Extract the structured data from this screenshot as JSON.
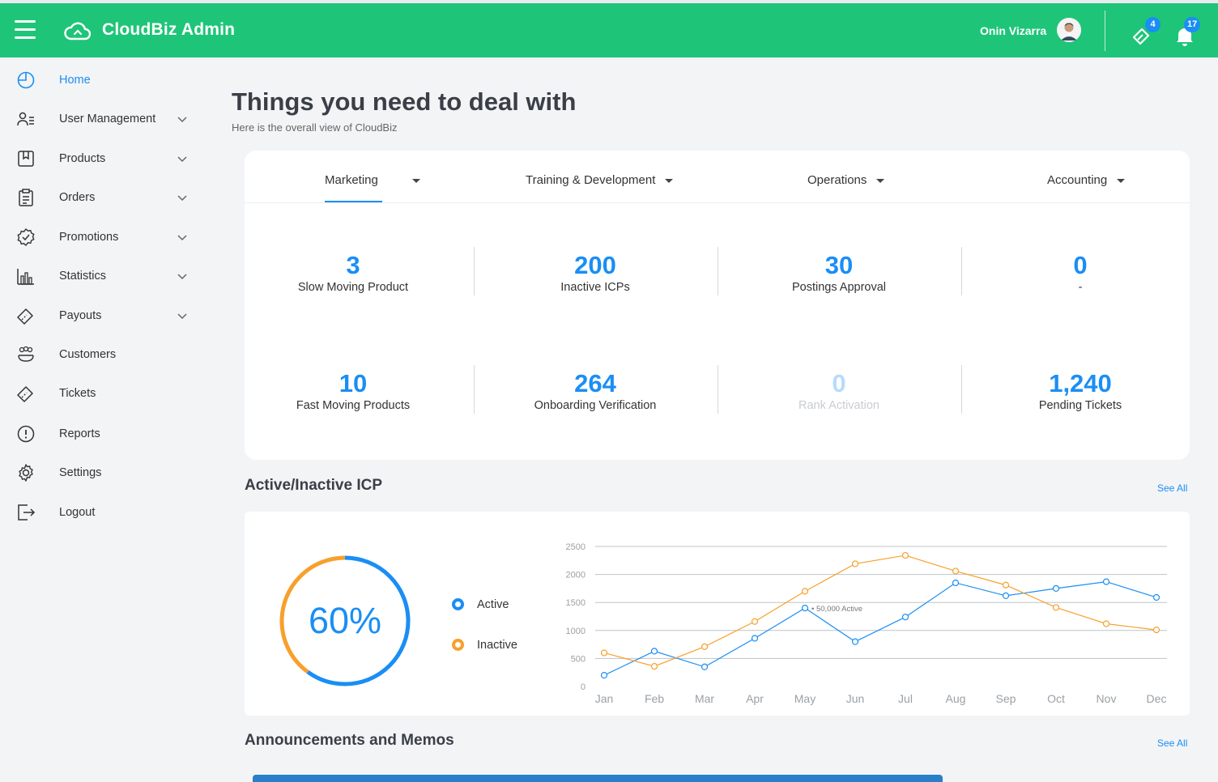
{
  "header": {
    "title": "CloudBiz Admin",
    "user_name": "Onin Vizarra",
    "ticket_badge": "4",
    "notification_badge": "17",
    "brand_color": "#1ec578",
    "accent_color": "#1a8ef5"
  },
  "sidebar": {
    "items": [
      {
        "label": "Home",
        "icon": "dashboard-icon",
        "active": true
      },
      {
        "label": "User Management",
        "icon": "users-icon",
        "expandable": true
      },
      {
        "label": "Products",
        "icon": "bookmark-icon",
        "expandable": true
      },
      {
        "label": "Orders",
        "icon": "clipboard-icon",
        "expandable": true
      },
      {
        "label": "Promotions",
        "icon": "badge-check-icon",
        "expandable": true
      },
      {
        "label": "Statistics",
        "icon": "bar-chart-icon",
        "expandable": true
      },
      {
        "label": "Payouts",
        "icon": "ticket-icon",
        "expandable": true
      },
      {
        "label": "Customers",
        "icon": "customers-icon"
      },
      {
        "label": "Tickets",
        "icon": "ticket-icon"
      },
      {
        "label": "Reports",
        "icon": "alert-circle-icon"
      },
      {
        "label": "Settings",
        "icon": "gear-icon"
      },
      {
        "label": "Logout",
        "icon": "logout-icon"
      }
    ]
  },
  "main": {
    "title": "Things you need to deal with",
    "subtitle": "Here is the overall view of CloudBiz",
    "tabs": [
      {
        "label": "Marketing",
        "active": true
      },
      {
        "label": "Training & Development"
      },
      {
        "label": "Operations"
      },
      {
        "label": "Accounting"
      }
    ],
    "stats": [
      {
        "value": "3",
        "label": "Slow Moving Product"
      },
      {
        "value": "200",
        "label": "Inactive ICPs"
      },
      {
        "value": "30",
        "label": "Postings Approval"
      },
      {
        "value": "0",
        "label": "-"
      },
      {
        "value": "10",
        "label": "Fast Moving Products"
      },
      {
        "value": "264",
        "label": "Onboarding Verification"
      },
      {
        "value": "0",
        "label": "Rank Activation",
        "muted": true
      },
      {
        "value": "1,240",
        "label": "Pending Tickets"
      }
    ]
  },
  "icp_section": {
    "title": "Active/Inactive ICP",
    "see_all": "See All",
    "percent_label": "60%",
    "active_fraction": 0.6,
    "legend": [
      {
        "label": "Active",
        "color": "#1a8ef5"
      },
      {
        "label": "Inactive",
        "color": "#f7a02c"
      }
    ]
  },
  "chart_data": {
    "type": "line",
    "x": [
      "Jan",
      "Feb",
      "Mar",
      "Apr",
      "May",
      "Jun",
      "Jul",
      "Aug",
      "Sep",
      "Oct",
      "Nov",
      "Dec"
    ],
    "yticks": [
      0,
      500,
      1000,
      1500,
      2000,
      2500
    ],
    "ylim": [
      0,
      2500
    ],
    "grid": true,
    "series": [
      {
        "name": "Active",
        "color": "#1a8ef5",
        "values": [
          200,
          630,
          350,
          860,
          1400,
          800,
          1240,
          1850,
          1620,
          1750,
          1870,
          1590
        ]
      },
      {
        "name": "Inactive",
        "color": "#f7a02c",
        "values": [
          600,
          360,
          710,
          1160,
          1700,
          2190,
          2340,
          2060,
          1810,
          1410,
          1120,
          1010
        ]
      }
    ],
    "annotations": [
      {
        "x": "May",
        "series": "Active",
        "text": "• 50,000 Active"
      }
    ]
  },
  "announcements": {
    "title": "Announcements and Memos",
    "see_all": "See All"
  }
}
